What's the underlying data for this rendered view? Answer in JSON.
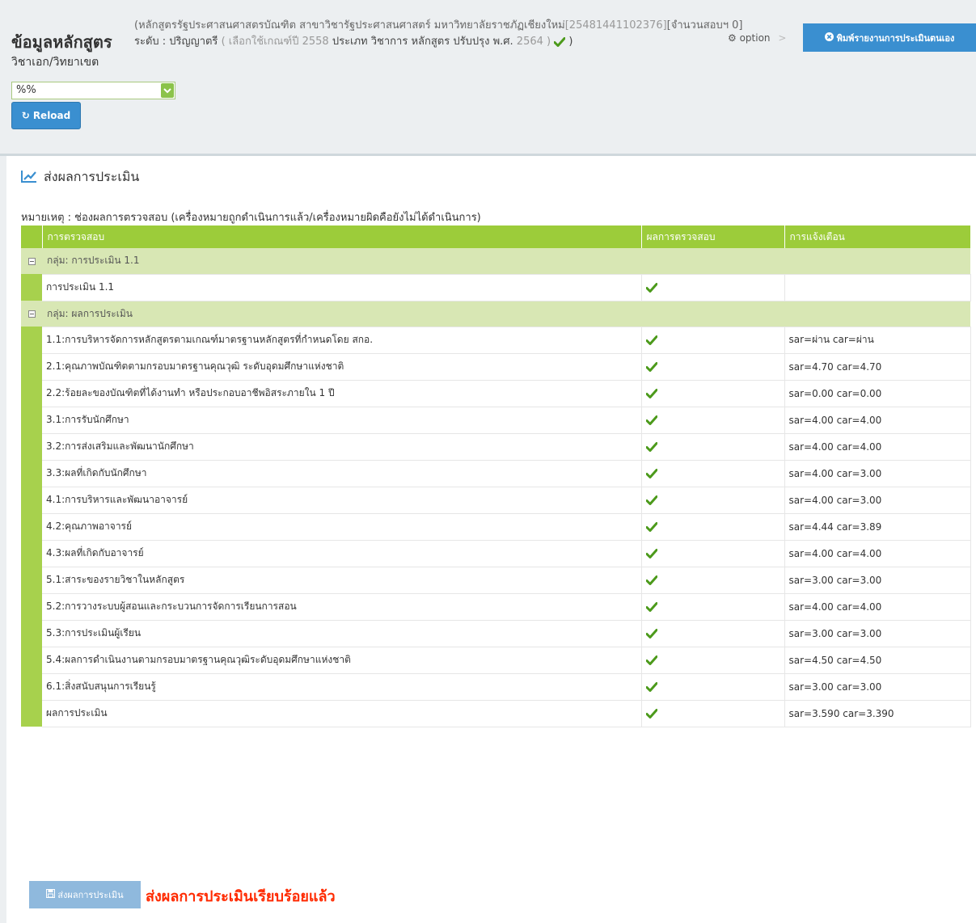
{
  "header": {
    "title": "ข้อมูลหลักสูตร",
    "subtitle_line1": "(หลักสูตรรัฐประศาสนศาสตรบัณฑิต สาขาวิชารัฐประศาสนศาสตร์ มหาวิทยาลัยราชภัฏเชียงใหม่",
    "subtitle_id": "[25481441102376]",
    "subtitle_trail": "[จำนวนสอบฯ 0]",
    "level_label": "ระดับ : ปริญญาตรี",
    "criteria_prefix": "( เลือกใช้เกณฑ์ปี",
    "criteria_year": "2558",
    "type_label": "ประเภท วิชาการ หลักสูตร ปรับปรุง พ.ศ.",
    "revision_year": "2564 )",
    "closing": ")",
    "option_label": "option",
    "option_sep": ">",
    "print_button_label": "พิมพ์รายงานการประเมินตนเอง"
  },
  "filter": {
    "major_label": "วิชาเอก/วิทยาเขต",
    "major_value": "%%",
    "reload_label": "Reload"
  },
  "section": {
    "title": "ส่งผลการประเมิน",
    "note": "หมายเหตุ : ช่องผลการตรวจสอบ (เครื่องหมายถูกดำเนินการแล้ว/เครื่องหมายผิดคือยังไม่ได้ดำเนินการ)"
  },
  "table": {
    "columns": [
      "การตรวจสอบ",
      "ผลการตรวจสอบ",
      "การแจ้งเตือน"
    ],
    "groups": [
      {
        "label": "กลุ่ม: การประเมิน 1.1",
        "rows": [
          {
            "item": "การประเมิน 1.1",
            "result": "check",
            "alert": ""
          }
        ]
      },
      {
        "label": "กลุ่ม: ผลการประเมิน",
        "rows": [
          {
            "item": "1.1:การบริหารจัดการหลักสูตรตามเกณฑ์มาตรฐานหลักสูตรที่กำหนดโดย สกอ.",
            "result": "check",
            "alert": "sar=ผ่าน car=ผ่าน"
          },
          {
            "item": "2.1:คุณภาพบัณฑิตตามกรอบมาตรฐานคุณวุฒิ ระดับอุดมศึกษาแห่งชาติ",
            "result": "check",
            "alert": "sar=4.70 car=4.70"
          },
          {
            "item": "2.2:ร้อยละของบัณฑิตที่ได้งานทำ หรือประกอบอาชีพอิสระภายใน 1 ปี",
            "result": "check",
            "alert": "sar=0.00 car=0.00"
          },
          {
            "item": "3.1:การรับนักศึกษา",
            "result": "check",
            "alert": "sar=4.00 car=4.00"
          },
          {
            "item": "3.2:การส่งเสริมและพัฒนานักศึกษา",
            "result": "check",
            "alert": "sar=4.00 car=4.00"
          },
          {
            "item": "3.3:ผลที่เกิดกับนักศึกษา",
            "result": "check",
            "alert": "sar=4.00 car=3.00"
          },
          {
            "item": "4.1:การบริหารและพัฒนาอาจารย์",
            "result": "check",
            "alert": "sar=4.00 car=3.00"
          },
          {
            "item": "4.2:คุณภาพอาจารย์",
            "result": "check",
            "alert": "sar=4.44 car=3.89"
          },
          {
            "item": "4.3:ผลที่เกิดกับอาจารย์",
            "result": "check",
            "alert": "sar=4.00 car=4.00"
          },
          {
            "item": "5.1:สาระของรายวิชาในหลักสูตร",
            "result": "check",
            "alert": "sar=3.00 car=3.00"
          },
          {
            "item": "5.2:การวางระบบผู้สอนและกระบวนการจัดการเรียนการสอน",
            "result": "check",
            "alert": "sar=4.00 car=4.00"
          },
          {
            "item": "5.3:การประเมินผู้เรียน",
            "result": "check",
            "alert": "sar=3.00 car=3.00"
          },
          {
            "item": "5.4:ผลการดำเนินงานตามกรอบมาตรฐานคุณวุฒิระดับอุดมศึกษาแห่งชาติ",
            "result": "check",
            "alert": "sar=4.50 car=4.50"
          },
          {
            "item": "6.1:สิ่งสนับสนุนการเรียนรู้",
            "result": "check",
            "alert": "sar=3.00 car=3.00"
          },
          {
            "item": "ผลการประเมิน",
            "result": "check",
            "alert": "sar=3.590 car=3.390"
          }
        ]
      }
    ]
  },
  "footer": {
    "submit_label": "ส่งผลการประเมิน",
    "status_text": "ส่งผลการประเมินเรียบร้อยแล้ว"
  },
  "colors": {
    "accent_green": "#9ccc3a",
    "group_row": "#d8e7b4",
    "check_green": "#4c9a1b",
    "button_blue": "#3a8fd0",
    "status_red": "#ff2a00"
  }
}
